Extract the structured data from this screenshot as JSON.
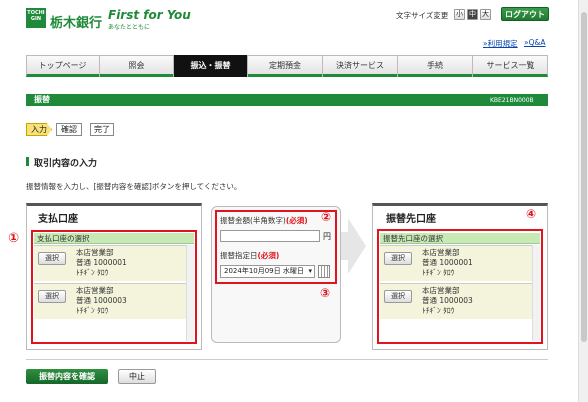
{
  "header": {
    "logo_mark": "TOCHIGIN",
    "bank_name": "栃木銀行",
    "slogan": "First for You",
    "slogan_sub": "あなたとともに",
    "font_size_label": "文字サイズ変更",
    "font_sizes": [
      "小",
      "中",
      "大"
    ],
    "logout_label": "ログアウト",
    "terms_link": "利用規定",
    "qa_link": "Q&A"
  },
  "nav": {
    "items": [
      "トップページ",
      "照会",
      "振込・振替",
      "定期預金",
      "決済サービス",
      "手続",
      "サービス一覧"
    ],
    "active_index": 2
  },
  "title_bar": {
    "title": "振替",
    "screen_code": "KBE21BN000B"
  },
  "steps": [
    "入力",
    "確認",
    "完了"
  ],
  "section_title": "取引内容の入力",
  "instruction": "振替情報を入力し、[振替内容を確認]ボタンを押してください。",
  "source": {
    "title": "支払口座",
    "subhead": "支払口座の選択",
    "number": "①",
    "accounts": [
      {
        "select": "選択",
        "branch": "本店営業部",
        "account": "普通 1000001",
        "name": "ﾄﾁｷﾞﾝ ﾀﾛｳ"
      },
      {
        "select": "選択",
        "branch": "本店営業部",
        "account": "普通 1000003",
        "name": "ﾄﾁｷﾞﾝ ﾀﾛｳ"
      }
    ]
  },
  "middle": {
    "amount_label": "振替金額(半角数字)",
    "amount_required": "(必須)",
    "amount_number": "②",
    "amount_value": "",
    "yen": "円",
    "date_label": "振替指定日",
    "date_required": "(必須)",
    "date_value": "2024年10月09日 水曜日",
    "date_number": "③"
  },
  "destination": {
    "title": "振替先口座",
    "subhead": "振替先口座の選択",
    "number": "④",
    "accounts": [
      {
        "select": "選択",
        "branch": "本店営業部",
        "account": "普通 1000001",
        "name": "ﾄﾁｷﾞﾝ ﾀﾛｳ"
      },
      {
        "select": "選択",
        "branch": "本店営業部",
        "account": "普通 1000003",
        "name": "ﾄﾁｷﾞﾝ ﾀﾛｳ"
      }
    ]
  },
  "actions": {
    "confirm": "振替内容を確認",
    "cancel": "中止"
  },
  "colors": {
    "brand_green": "#1f8a3a",
    "accent_red": "#e0141e",
    "subhead_green": "#c8e8b4"
  }
}
